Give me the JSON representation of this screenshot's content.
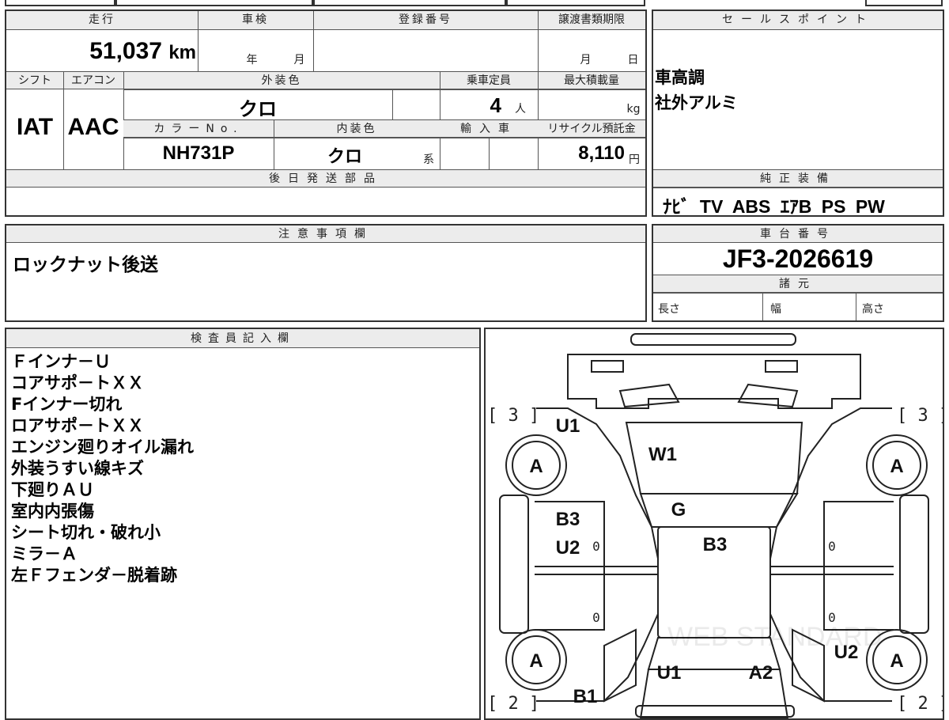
{
  "mileage": {
    "label": "走行",
    "value": "51,037",
    "unit": "km"
  },
  "inspection": {
    "label": "車検",
    "year_unit": "年",
    "month_unit": "月"
  },
  "registration": {
    "label": "登録番号"
  },
  "transfer": {
    "label": "譲渡書類期限",
    "month_unit": "月",
    "day_unit": "日"
  },
  "shift": {
    "label": "シフト",
    "value": "IAT"
  },
  "aircon": {
    "label": "エアコン",
    "value": "AAC"
  },
  "exterior_color": {
    "label": "外装色",
    "value": "クロ"
  },
  "capacity": {
    "label": "乗車定員",
    "value": "4",
    "unit": "人"
  },
  "max_load": {
    "label": "最大積載量",
    "unit": "kg"
  },
  "color_no": {
    "label": "カラーNo.",
    "value": "NH731P"
  },
  "interior_color": {
    "label": "内装色",
    "value": "クロ",
    "unit": "系"
  },
  "import": {
    "label": "輸入車"
  },
  "recycle": {
    "label": "リサイクル預託金",
    "value": "8,110",
    "unit": "円"
  },
  "later_parts": {
    "label": "後日発送部品"
  },
  "sales_point": {
    "label": "セールスポイント",
    "lines": [
      "車高調",
      "社外アルミ"
    ]
  },
  "genuine_equipment": {
    "label": "純正装備",
    "value": "ﾅﾋﾞ TV ABS ｴｱB PS PW"
  },
  "caution": {
    "label": "注意事項欄",
    "value": "ロックナット後送"
  },
  "chassis": {
    "label": "車台番号",
    "value": "JF3-2026619"
  },
  "specs": {
    "label": "諸元",
    "length": "長さ",
    "width": "幅",
    "height": "高さ"
  },
  "inspector": {
    "label": "検査員記入欄",
    "lines": [
      "Ｆインナ－Ｕ",
      "コアサポ－トＸＸ",
      "Fインナー切れ",
      "ロアサポ－トＸＸ",
      "エンジン廻りオイル漏れ",
      "外装うすい線キズ",
      "下廻りＡＵ",
      "室内内張傷",
      "シート切れ・破れ小",
      "ミラ－Ａ",
      "左Ｆフェンダ－脱着跡"
    ]
  },
  "diagram": {
    "tire_front_left": "A",
    "tire_front_right": "A",
    "tire_rear_left": "A",
    "tire_rear_right": "A",
    "tread_front_left": "[ 3 ]",
    "tread_front_right": "[ 3 ]",
    "tread_rear_left": "[ 2 ]",
    "tread_rear_right": "[ 2 ]",
    "front_left_fender": "U1",
    "windshield": "W1",
    "roof_front": "G",
    "left_door_front": "B3",
    "left_door_front2": "U2",
    "roof": "B3",
    "rear_panel_left": "U1",
    "rear_panel_right": "A2",
    "right_rear_fender": "U2",
    "left_rear": "B1",
    "zero_marks": [
      "0",
      "0",
      "0",
      "0"
    ],
    "watermark": "WEB STANDARD"
  }
}
